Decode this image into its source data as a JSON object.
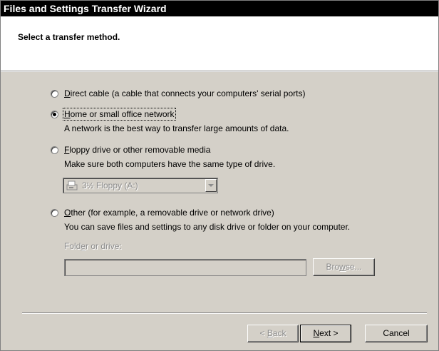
{
  "window": {
    "title": "Files and Settings Transfer Wizard"
  },
  "header": {
    "title": "Select a transfer method."
  },
  "options": [
    {
      "label_underline": "D",
      "label_rest": "irect cable (a cable that connects your computers' serial ports)",
      "checked": false
    },
    {
      "label_underline": "H",
      "label_rest": "ome or small office network",
      "checked": true,
      "description": "A network is the best way to transfer large amounts of data."
    },
    {
      "label_underline": "F",
      "label_rest": "loppy drive or other removable media",
      "checked": false,
      "description": "Make sure both computers have the same type of drive."
    },
    {
      "label_underline": "O",
      "label_rest": "ther (for example, a removable drive or network drive)",
      "checked": false,
      "description": "You can save files and settings to any disk drive or folder on your computer."
    }
  ],
  "floppy_select": {
    "value": "3½ Floppy (A:)",
    "icon": "floppy-drive-icon"
  },
  "folder": {
    "label_before": "Fold",
    "label_underline": "e",
    "label_after": "r or drive:",
    "value": ""
  },
  "browse": {
    "label_before": "Bro",
    "label_underline": "w",
    "label_after": "se..."
  },
  "buttons": {
    "back_underline": "B",
    "back_rest": "ack",
    "back_prefix": "< ",
    "next_underline": "N",
    "next_rest": "ext >",
    "cancel": "Cancel"
  },
  "colors": {
    "titlebar": "#000000",
    "dialog": "#d4d0c8",
    "disabled_text": "#8c8c8c"
  }
}
